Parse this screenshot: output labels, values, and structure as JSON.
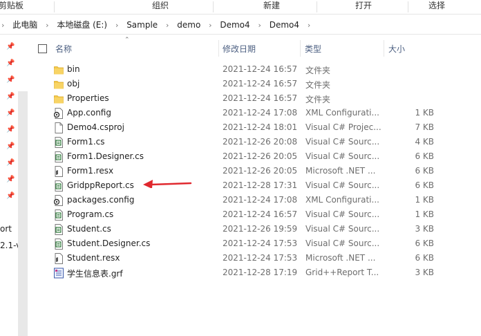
{
  "ribbon": {
    "groups": [
      "剪贴板",
      "组织",
      "新建",
      "打开",
      "选择"
    ]
  },
  "address": {
    "crumbs": [
      "此电脑",
      "本地磁盘 (E:)",
      "Sample",
      "demo",
      "Demo4",
      "Demo4"
    ]
  },
  "nav": {
    "fragments": [
      "ort",
      "2.1-v"
    ]
  },
  "columns": {
    "name": "名称",
    "modified": "修改日期",
    "type": "类型",
    "size": "大小"
  },
  "files": [
    {
      "name": "bin",
      "modified": "2021-12-24 16:57",
      "type": "文件夹",
      "size": "",
      "icon": "folder-icon"
    },
    {
      "name": "obj",
      "modified": "2021-12-24 16:57",
      "type": "文件夹",
      "size": "",
      "icon": "folder-icon"
    },
    {
      "name": "Properties",
      "modified": "2021-12-24 16:57",
      "type": "文件夹",
      "size": "",
      "icon": "folder-icon"
    },
    {
      "name": "App.config",
      "modified": "2021-12-24 17:08",
      "type": "XML Configurati...",
      "size": "1 KB",
      "icon": "config-file-icon"
    },
    {
      "name": "Demo4.csproj",
      "modified": "2021-12-24 18:01",
      "type": "Visual C# Projec...",
      "size": "7 KB",
      "icon": "blank-file-icon"
    },
    {
      "name": "Form1.cs",
      "modified": "2021-12-26 20:08",
      "type": "Visual C# Sourc...",
      "size": "4 KB",
      "icon": "source-file-icon"
    },
    {
      "name": "Form1.Designer.cs",
      "modified": "2021-12-26 20:05",
      "type": "Visual C# Sourc...",
      "size": "6 KB",
      "icon": "source-file-icon"
    },
    {
      "name": "Form1.resx",
      "modified": "2021-12-26 20:05",
      "type": "Microsoft .NET ...",
      "size": "6 KB",
      "icon": "resx-file-icon"
    },
    {
      "name": "GridppReport.cs",
      "modified": "2021-12-28 17:31",
      "type": "Visual C# Sourc...",
      "size": "6 KB",
      "icon": "source-file-icon"
    },
    {
      "name": "packages.config",
      "modified": "2021-12-24 17:08",
      "type": "XML Configurati...",
      "size": "1 KB",
      "icon": "config-file-icon"
    },
    {
      "name": "Program.cs",
      "modified": "2021-12-24 16:57",
      "type": "Visual C# Sourc...",
      "size": "1 KB",
      "icon": "source-file-icon"
    },
    {
      "name": "Student.cs",
      "modified": "2021-12-26 19:59",
      "type": "Visual C# Sourc...",
      "size": "3 KB",
      "icon": "source-file-icon"
    },
    {
      "name": "Student.Designer.cs",
      "modified": "2021-12-24 17:53",
      "type": "Visual C# Sourc...",
      "size": "6 KB",
      "icon": "source-file-icon"
    },
    {
      "name": "Student.resx",
      "modified": "2021-12-24 17:53",
      "type": "Microsoft .NET ...",
      "size": "6 KB",
      "icon": "resx-file-icon"
    },
    {
      "name": "学生信息表.grf",
      "modified": "2021-12-28 17:19",
      "type": "Grid++Report T...",
      "size": "3 KB",
      "icon": "grf-file-icon"
    }
  ],
  "colors": {
    "folder": "#f5c94a",
    "header_text": "#4d6082",
    "annotation_arrow": "#e0282e"
  }
}
